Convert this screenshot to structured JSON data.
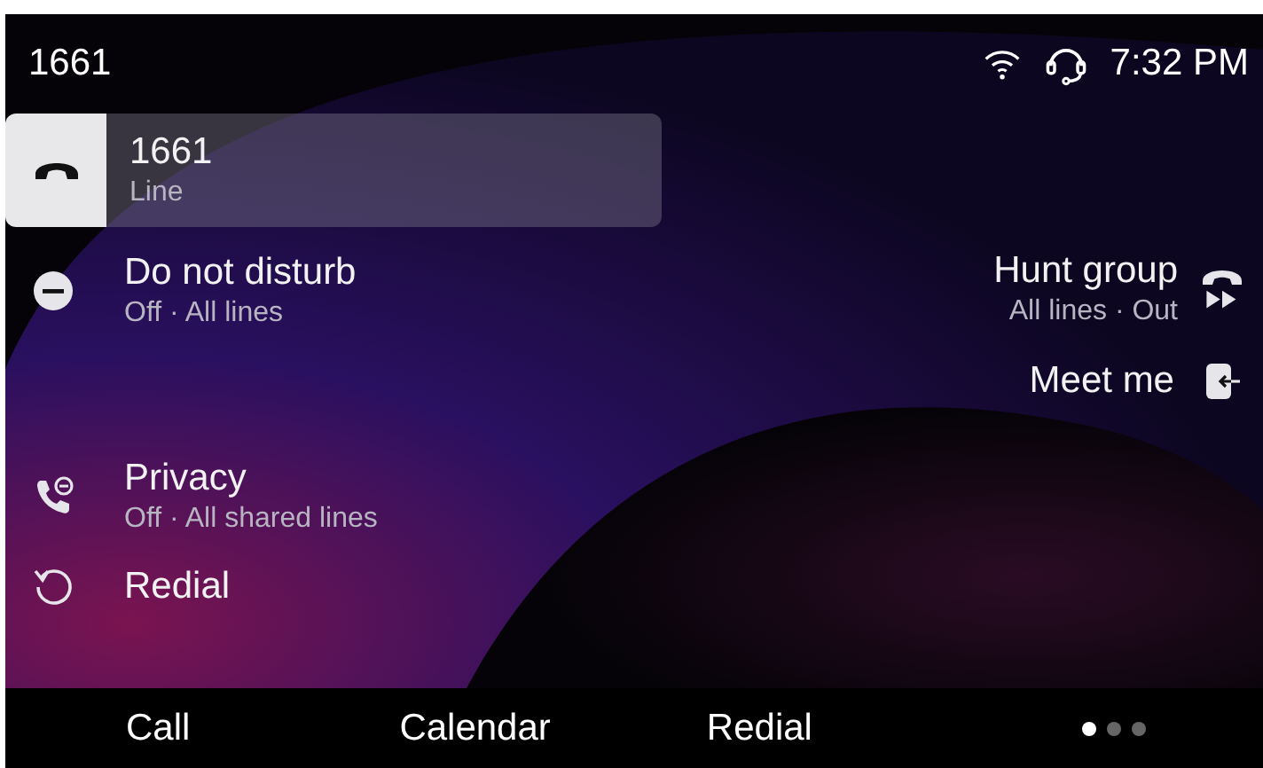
{
  "status_bar": {
    "title": "1661",
    "time": "7:32 PM"
  },
  "line": {
    "label": "1661",
    "sublabel": "Line",
    "selected": true
  },
  "left_features": [
    {
      "kind": "dnd",
      "label": "Do not disturb",
      "status": "Off · All lines"
    },
    {
      "kind": "privacy",
      "label": "Privacy",
      "status": "Off · All shared lines"
    },
    {
      "kind": "redial",
      "label": "Redial"
    }
  ],
  "right_features": [
    {
      "kind": "hunt",
      "label": "Hunt group",
      "status": "All lines · Out"
    },
    {
      "kind": "meetme",
      "label": "Meet me"
    }
  ],
  "softkeys": [
    "Call",
    "Calendar",
    "Redial"
  ],
  "pages": [
    {
      "selected": true
    },
    {
      "selected": false
    },
    {
      "selected": false
    }
  ]
}
